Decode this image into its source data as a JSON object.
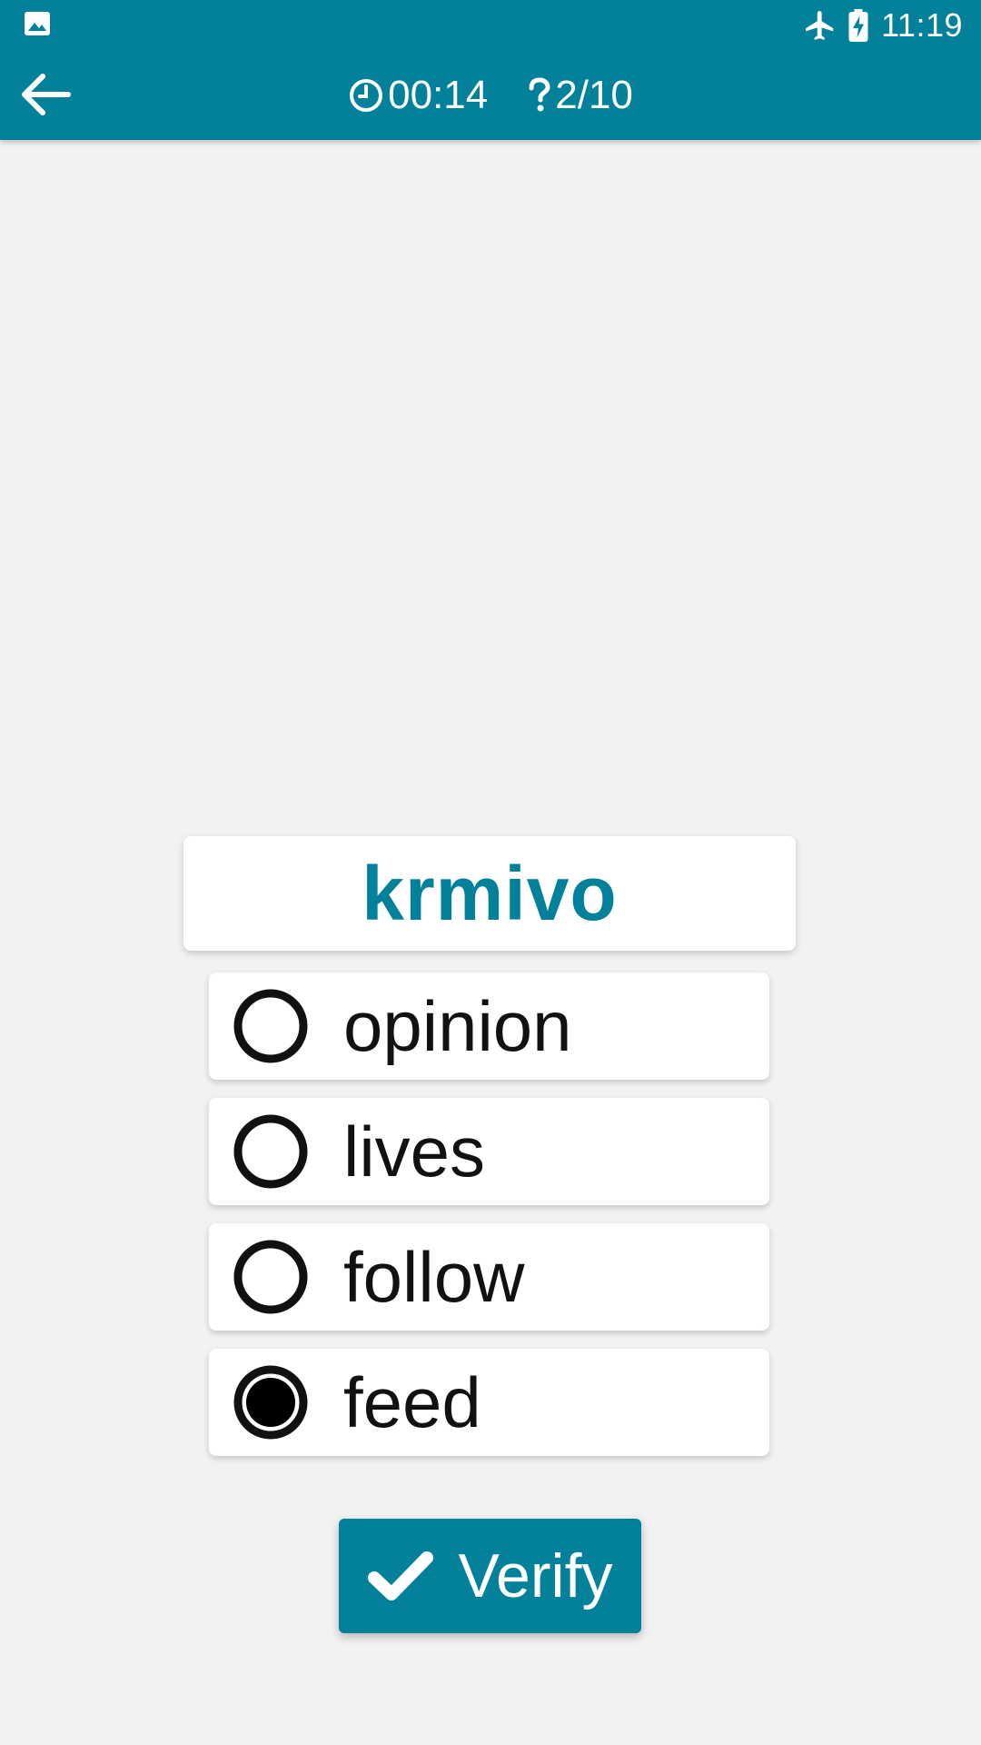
{
  "status_bar": {
    "time": "11:19",
    "left_icon": "gallery-icon",
    "icons": [
      "airplane-icon",
      "battery-charging-icon"
    ]
  },
  "header": {
    "back_icon": "arrow-back-icon",
    "timer_icon": "clock-icon",
    "timer": "00:14",
    "progress_icon": "question-icon",
    "progress": "2/10"
  },
  "quiz": {
    "word": "krmivo",
    "options": [
      {
        "label": "opinion",
        "selected": false
      },
      {
        "label": "lives",
        "selected": false
      },
      {
        "label": "follow",
        "selected": false
      },
      {
        "label": "feed",
        "selected": true
      }
    ]
  },
  "actions": {
    "verify_label": "Verify",
    "verify_icon": "check-icon"
  },
  "colors": {
    "primary": "#04819a",
    "background": "#f2f2f4",
    "card": "#ffffff",
    "text": "#111111"
  }
}
